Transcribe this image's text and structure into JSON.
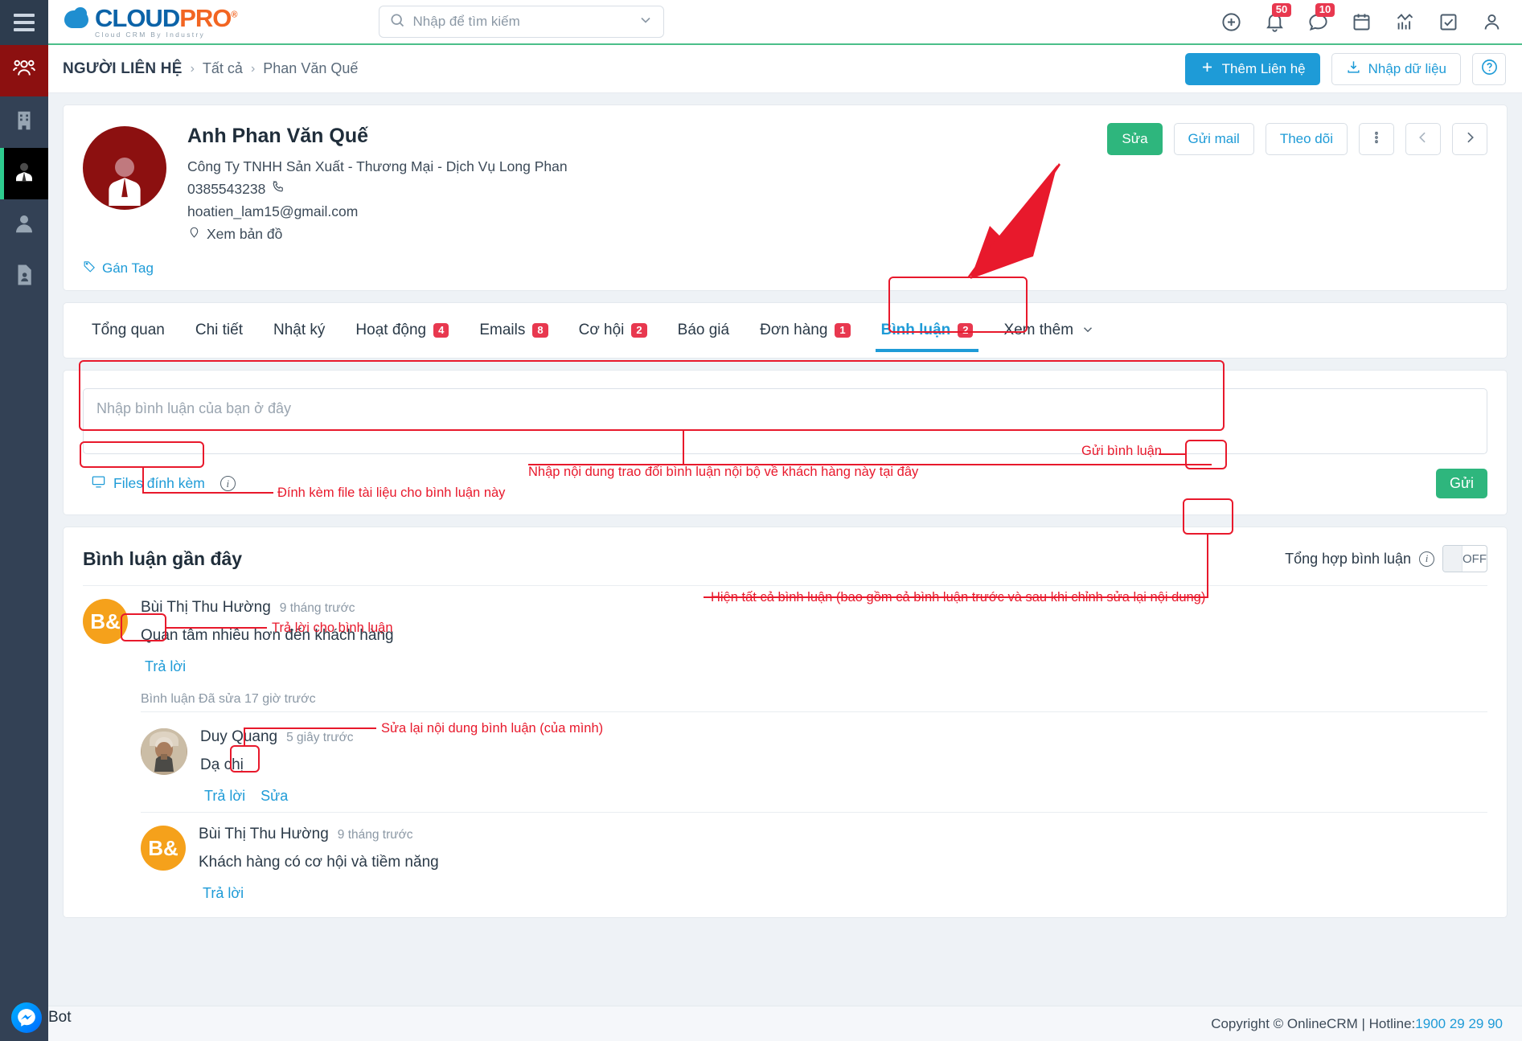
{
  "sidebar": {
    "items": [
      {
        "name": "contacts",
        "icon": "people-icon",
        "state": "active-red"
      },
      {
        "name": "companies",
        "icon": "building-icon",
        "state": ""
      },
      {
        "name": "leads",
        "icon": "person-tie-icon",
        "state": "active-dark"
      },
      {
        "name": "users",
        "icon": "person-icon",
        "state": ""
      },
      {
        "name": "documents",
        "icon": "document-person-icon",
        "state": ""
      }
    ],
    "menu_icon": "hamburger-menu-icon"
  },
  "brand": {
    "cloud": "CLOUD",
    "pro": "PRO",
    "reg": "®",
    "tagline": "Cloud CRM By Industry"
  },
  "search": {
    "placeholder": "Nhập để tìm kiếm",
    "icon": "search-icon",
    "chevron": "chevron-down-icon"
  },
  "topicons": [
    {
      "name": "add-icon",
      "badge": ""
    },
    {
      "name": "bell-icon",
      "badge": "50"
    },
    {
      "name": "chat-icon",
      "badge": "10"
    },
    {
      "name": "calendar-icon",
      "badge": ""
    },
    {
      "name": "chart-icon",
      "badge": ""
    },
    {
      "name": "task-check-icon",
      "badge": ""
    },
    {
      "name": "user-account-icon",
      "badge": ""
    }
  ],
  "breadcrumb": {
    "root": "NGƯỜI LIÊN HỆ",
    "sep": "›",
    "all": "Tất cả",
    "current": "Phan Văn Quế"
  },
  "crumb_actions": {
    "add_contact": "Thêm Liên hệ",
    "add_icon": "plus-icon",
    "import": "Nhập dữ liệu",
    "import_icon": "download-icon",
    "help": "?",
    "help_icon": "help-circle-icon"
  },
  "contact": {
    "name": "Anh Phan Văn Quế",
    "company": "Công Ty TNHH Sản Xuất - Thương Mại - Dịch Vụ Long Phan",
    "phone": "0385543238",
    "phone_icon": "phone-icon",
    "email": "hoatien_lam15@gmail.com",
    "map_label": "Xem bản đồ",
    "map_icon": "location-pin-icon",
    "tag_label": "Gán Tag",
    "tag_icon": "tag-icon",
    "avatar_icon": "user-avatar-icon",
    "actions": {
      "edit": "Sửa",
      "send_mail": "Gửi mail",
      "follow": "Theo dõi",
      "more_icon": "vertical-dots-icon",
      "prev_icon": "chevron-left-icon",
      "next_icon": "chevron-right-icon"
    }
  },
  "tabs": [
    {
      "label": "Tổng quan",
      "count": "",
      "active": false
    },
    {
      "label": "Chi tiết",
      "count": "",
      "active": false
    },
    {
      "label": "Nhật ký",
      "count": "",
      "active": false
    },
    {
      "label": "Hoạt động",
      "count": "4",
      "active": false
    },
    {
      "label": "Emails",
      "count": "8",
      "active": false
    },
    {
      "label": "Cơ hội",
      "count": "2",
      "active": false
    },
    {
      "label": "Báo giá",
      "count": "",
      "active": false
    },
    {
      "label": "Đơn hàng",
      "count": "1",
      "active": false
    },
    {
      "label": "Bình luận",
      "count": "2",
      "active": true
    },
    {
      "label": "Xem thêm",
      "count": "",
      "active": false,
      "chevron": true
    }
  ],
  "composer": {
    "placeholder": "Nhập bình luận của bạn ở đây",
    "attach_label": "Files đính kèm",
    "attach_icon": "monitor-upload-icon",
    "info_icon": "info-circle-icon",
    "send_label": "Gửi"
  },
  "comments_section": {
    "title": "Bình luận gần đây",
    "aggregate_label": "Tổng hợp bình luận",
    "aggregate_info_icon": "info-circle-icon",
    "toggle_state": "OFF"
  },
  "comments": [
    {
      "author": "Bùi Thị Thu Hường",
      "initials": "B&",
      "time": "9 tháng trước",
      "text": "Quan tâm nhiều hơn đến khách hàng",
      "reply_label": "Trả lời",
      "edited_note": "Bình luận Đã sửa 17 giờ trước",
      "avatar_kind": "orange",
      "replies": [
        {
          "author": "Duy Quang",
          "time": "5 giây trước",
          "text": "Dạ chị",
          "reply_label": "Trả lời",
          "edit_label": "Sửa",
          "avatar_kind": "photo"
        }
      ]
    },
    {
      "author": "Bùi Thị Thu Hường",
      "initials": "B&",
      "time": "9 tháng trước",
      "text": "Khách hàng có cơ hội và tiềm năng",
      "reply_label": "Trả lời",
      "avatar_kind": "orange",
      "replies": []
    }
  ],
  "annotations": {
    "attach_note": "Đính kèm file tài liệu cho bình luận này",
    "compose_note": "Nhập nội dung trao đổi bình luận nội bộ về khách hàng này tại đây",
    "send_note": "Gửi bình luận",
    "aggregate_note": "Hiện tất cả bình luận (bao gồm cả bình luận trước và sau khi chỉnh sửa lại nội dung)",
    "reply_note": "Trả lời cho bình luận",
    "edit_note": "Sửa lại nội dung bình luận (của mình)"
  },
  "footer": {
    "copyright": "Copyright © OnlineCRM | Hotline: ",
    "hotline": "1900 29 29 90"
  },
  "chat_widget": {
    "label": "Bot",
    "icon": "messenger-icon"
  },
  "colors": {
    "brand_blue": "#1e9bd7",
    "brand_orange": "#f26522",
    "accent_green": "#2eb67d",
    "badge_red": "#e8384f",
    "annotation_red": "#e8192c",
    "rail_dark": "#334155",
    "avatar_red": "#8c1010",
    "avatar_orange": "#f5a11b"
  }
}
